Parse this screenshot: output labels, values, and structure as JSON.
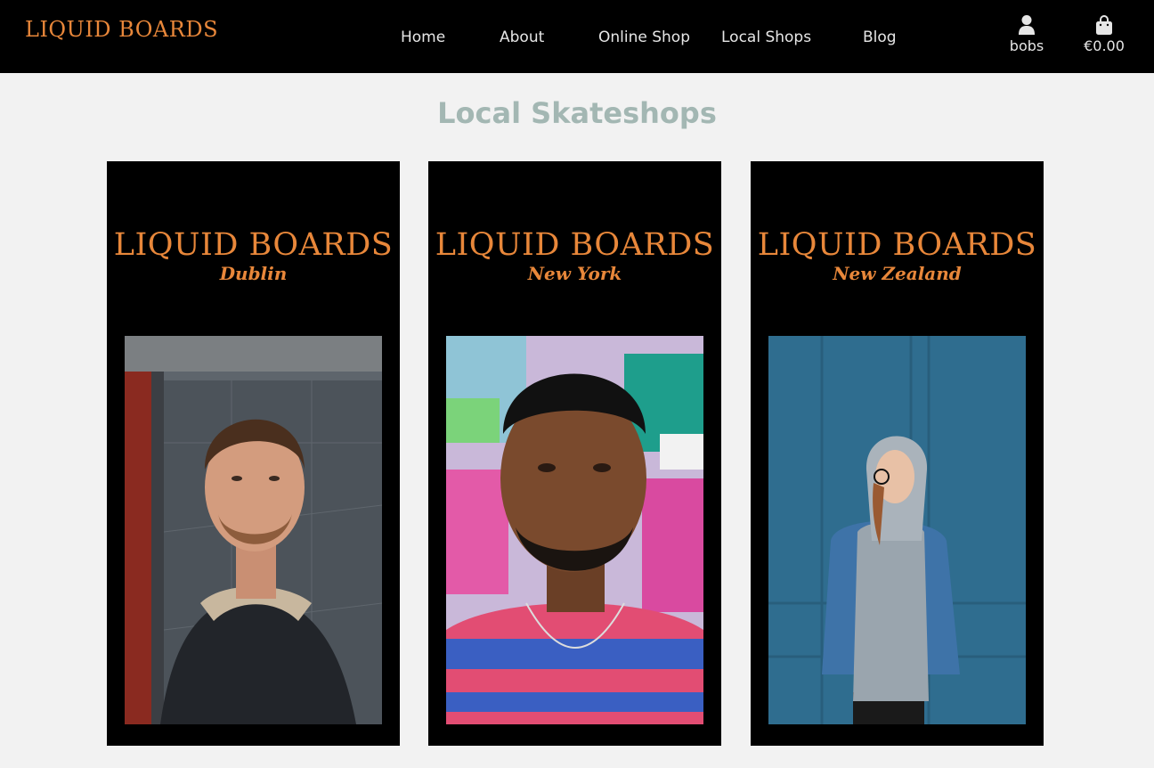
{
  "header": {
    "brand": "LIQUID BOARDS",
    "nav": [
      "Home",
      "About",
      "Online Shop",
      "Local Shops",
      "Blog"
    ],
    "account_label": "bobs",
    "bag_total": "€0.00",
    "icons": {
      "account": "user-icon",
      "bag": "shopping-bag-icon"
    }
  },
  "main": {
    "title": "Local Skateshops",
    "cards": [
      {
        "brand": "LIQUID BOARDS",
        "city": "Dublin"
      },
      {
        "brand": "LIQUID BOARDS",
        "city": "New York"
      },
      {
        "brand": "LIQUID BOARDS",
        "city": "New Zealand"
      }
    ]
  },
  "colors": {
    "accent": "#e8873a",
    "title": "#a3b7b3",
    "navbar": "#000000",
    "background": "#f2f2f2"
  }
}
